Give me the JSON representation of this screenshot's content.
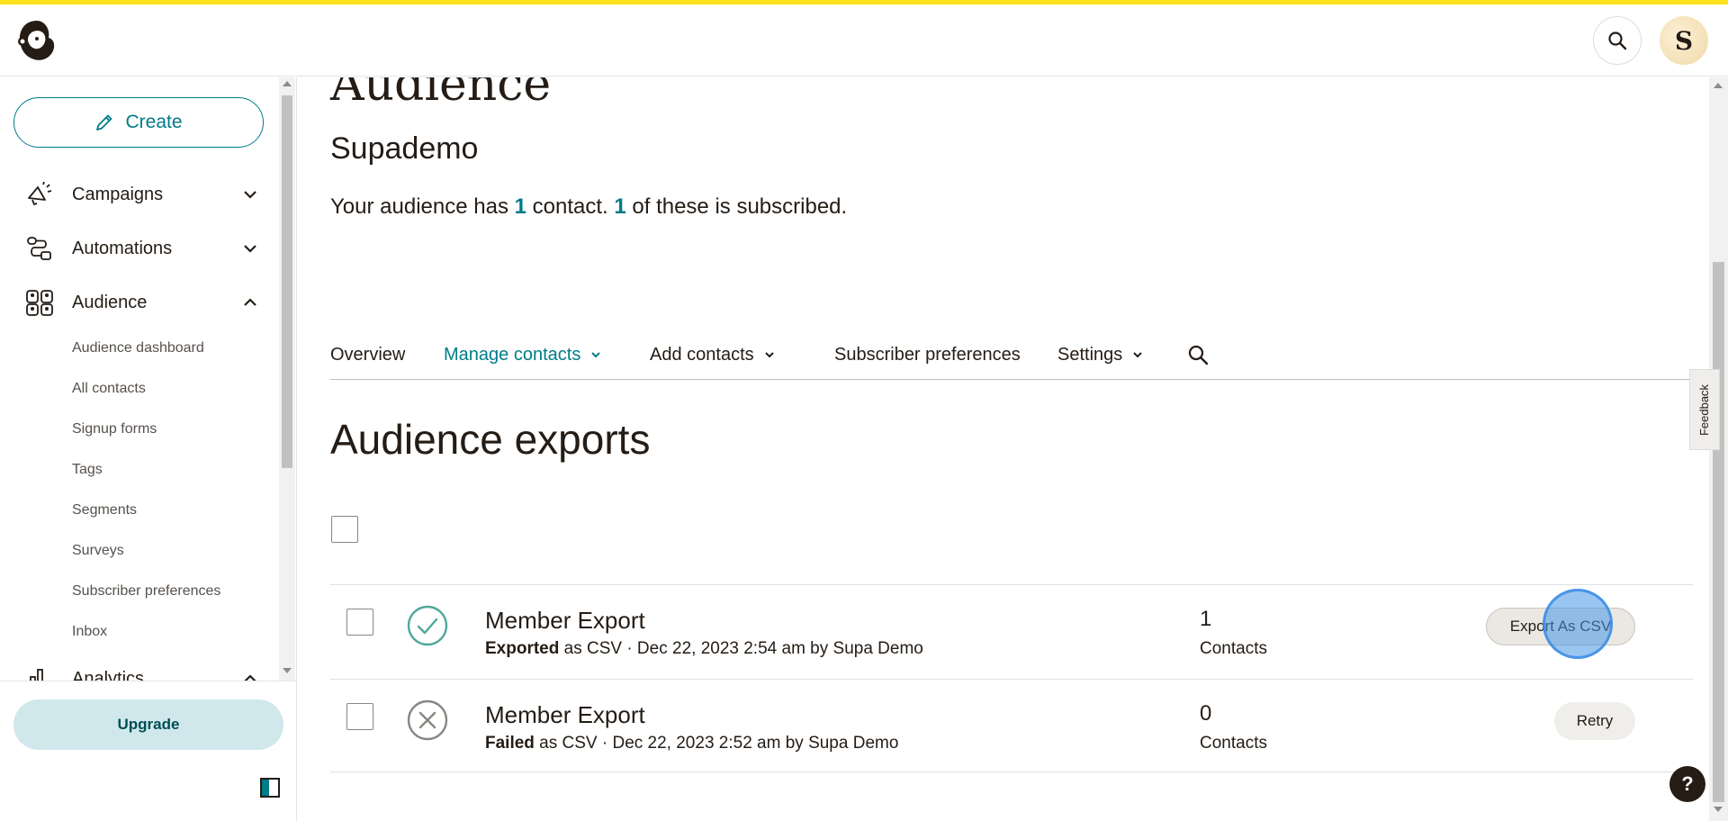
{
  "header": {
    "search_icon": "search-icon",
    "avatar_initial": "S"
  },
  "sidebar": {
    "create_label": "Create",
    "nav": [
      {
        "label": "Campaigns",
        "icon": "megaphone-icon",
        "expanded": false
      },
      {
        "label": "Automations",
        "icon": "flow-icon",
        "expanded": false
      },
      {
        "label": "Audience",
        "icon": "audience-icon",
        "expanded": true
      }
    ],
    "audience_sub": [
      "Audience dashboard",
      "All contacts",
      "Signup forms",
      "Tags",
      "Segments",
      "Surveys",
      "Subscriber preferences",
      "Inbox"
    ],
    "partial_item": "Analytics",
    "upgrade_label": "Upgrade"
  },
  "main": {
    "page_title": "Audience",
    "audience_name": "Supademo",
    "summary": {
      "prefix": "Your audience has ",
      "contacts_count": "1",
      "middle": " contact. ",
      "subscribed_count": "1",
      "suffix": " of these is subscribed."
    },
    "tabs": [
      {
        "label": "Overview",
        "dropdown": false,
        "active": false
      },
      {
        "label": "Manage contacts",
        "dropdown": true,
        "active": true
      },
      {
        "label": "Add contacts",
        "dropdown": true,
        "active": false
      },
      {
        "label": "Subscriber preferences",
        "dropdown": false,
        "active": false
      },
      {
        "label": "Settings",
        "dropdown": true,
        "active": false
      }
    ],
    "exports_title": "Audience exports",
    "exports": [
      {
        "name": "Member Export",
        "status": "Exported",
        "meta": " as CSV · Dec 22, 2023 2:54 am by Supa Demo",
        "count": "1",
        "count_label": "Contacts",
        "action": "Export As CSV"
      },
      {
        "name": "Member Export",
        "status": "Failed",
        "meta": " as CSV · Dec 22, 2023 2:52 am by Supa Demo",
        "count": "0",
        "count_label": "Contacts",
        "action": "Retry"
      }
    ]
  },
  "feedback_label": "Feedback",
  "help_label": "?",
  "colors": {
    "accent": "#007c89",
    "brand_yellow": "#ffe01b",
    "upgrade_bg": "#d0e8ec"
  }
}
